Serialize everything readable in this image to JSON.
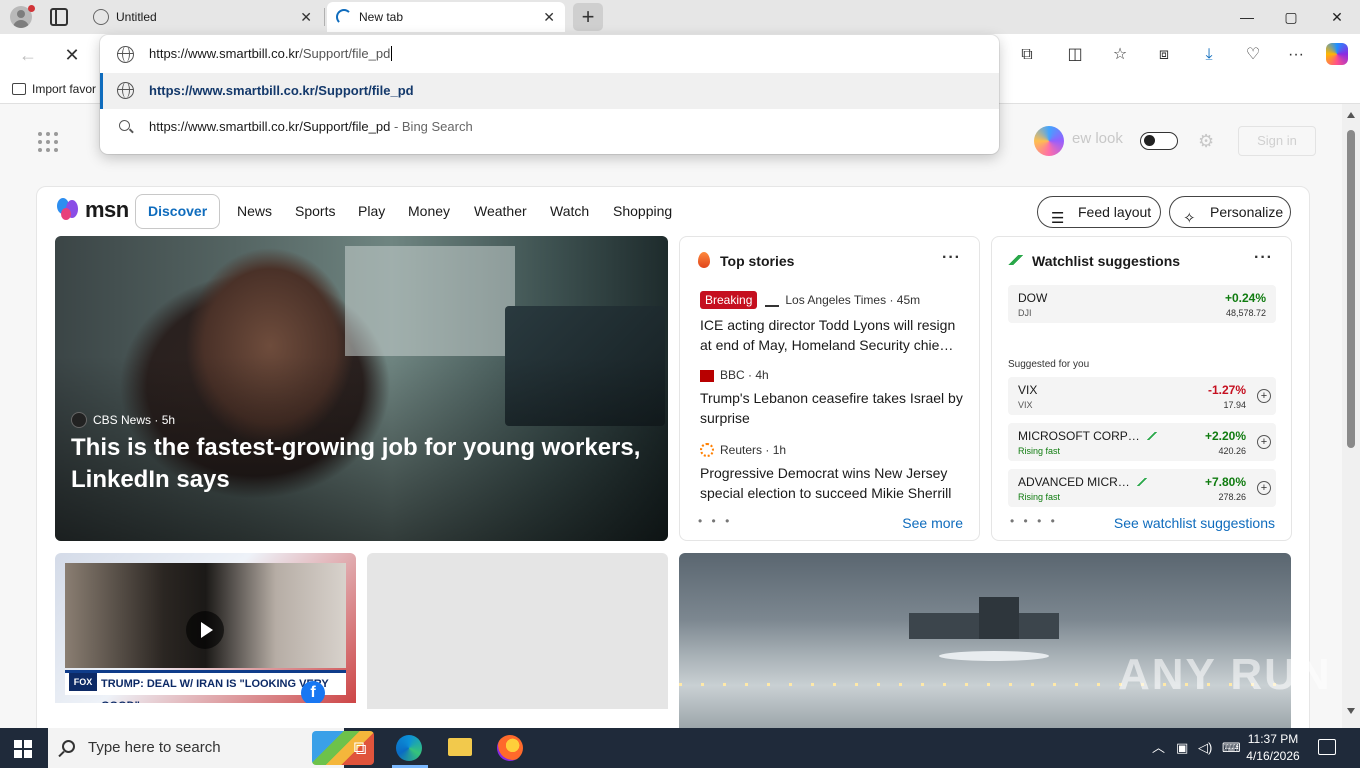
{
  "browser": {
    "tabs": [
      {
        "title": "Untitled",
        "active": false
      },
      {
        "title": "New tab",
        "active": true
      }
    ],
    "new_tab_symbol": "+",
    "close_symbol": "✕",
    "window_controls": {
      "minimize": "—",
      "maximize": "▢",
      "close": "✕"
    },
    "favorites": {
      "import_label": "Import favor"
    },
    "omnibox": {
      "typed_host": "https://www.smartbill.co.kr",
      "typed_path": "/Support/file_pd",
      "suggestions": [
        {
          "text": "https://www.smartbill.co.kr/Support/file_pd",
          "type": "url"
        },
        {
          "text": "https://www.smartbill.co.kr/Support/file_pd",
          "suffix": " - Bing Search",
          "type": "search"
        }
      ]
    }
  },
  "page_header": {
    "new_look_label": "ew look",
    "sign_in_label": "Sign in"
  },
  "msn": {
    "logo_text": "msn",
    "nav": [
      "Discover",
      "News",
      "Sports",
      "Play",
      "Money",
      "Weather",
      "Watch",
      "Shopping"
    ],
    "feed_layout_label": "Feed layout",
    "personalize_label": "Personalize",
    "hero": {
      "source": "CBS News",
      "age": "5h",
      "headline": "This is the fastest-growing job for young workers, LinkedIn says"
    },
    "top_stories": {
      "title": "Top stories",
      "more": "···",
      "stories": [
        {
          "badge": "Breaking",
          "source": "Los Angeles Times",
          "age": "45m",
          "title": "ICE acting director Todd Lyons will resign at end of May, Homeland Security chie…"
        },
        {
          "source": "BBC",
          "age": "4h",
          "title": "Trump's Lebanon ceasefire takes Israel by surprise"
        },
        {
          "source": "Reuters",
          "age": "1h",
          "title": "Progressive Democrat wins New Jersey special election to succeed Mikie Sherrill"
        }
      ],
      "pager": "• • •",
      "see_more": "See more"
    },
    "watchlist": {
      "title": "Watchlist suggestions",
      "more": "···",
      "pinned": {
        "name": "DOW",
        "symbol": "DJI",
        "change": "+0.24%",
        "price": "48,578.72",
        "change_color": "#107c10"
      },
      "suggested_label": "Suggested for you",
      "suggested": [
        {
          "name": "VIX",
          "sub": "VIX",
          "change": "-1.27%",
          "price": "17.94",
          "change_color": "#c50f1f",
          "trend": false
        },
        {
          "name": "MICROSOFT CORP…",
          "sub": "Rising fast",
          "change": "+2.20%",
          "price": "420.26",
          "change_color": "#107c10",
          "trend": true
        },
        {
          "name": "ADVANCED MICR…",
          "sub": "Rising fast",
          "change": "+7.80%",
          "price": "278.26",
          "change_color": "#107c10",
          "trend": true
        }
      ],
      "pager": "• • • •",
      "see_more": "See watchlist suggestions"
    },
    "video_card": {
      "ticker": "TRUMP: DEAL W/ IRAN IS \"LOOKING VERY GOOD\"",
      "network": "FOX"
    }
  },
  "watermark": "ANY RUN",
  "taskbar": {
    "search_placeholder": "Type here to search",
    "time": "11:37 PM",
    "date": "4/16/2026"
  }
}
